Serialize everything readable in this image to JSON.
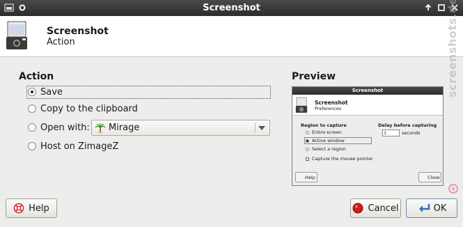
{
  "window": {
    "title": "Screenshot"
  },
  "header": {
    "title": "Screenshot",
    "subtitle": "Action"
  },
  "action": {
    "title": "Action",
    "options": [
      {
        "label": "Save",
        "checked": true
      },
      {
        "label": "Copy to the clipboard",
        "checked": false
      },
      {
        "label": "Open with:",
        "checked": false
      },
      {
        "label": "Host on ZimageZ",
        "checked": false
      }
    ],
    "open_with_app": "Mirage"
  },
  "preview": {
    "title": "Preview",
    "window_title": "Screenshot",
    "header_title": "Screenshot",
    "header_subtitle": "Preferences",
    "region_title": "Region to capture",
    "region_options": [
      "Entire screen",
      "Active window",
      "Select a region"
    ],
    "capture_pointer": "Capture the mouse pointer",
    "delay_title": "Delay before capturing",
    "delay_value": "1",
    "delay_unit": "seconds",
    "help_label": "Help",
    "close_label": "Close"
  },
  "buttons": {
    "help": "Help",
    "cancel": "Cancel",
    "ok": "OK"
  },
  "watermark": "screenshots.debian.net"
}
